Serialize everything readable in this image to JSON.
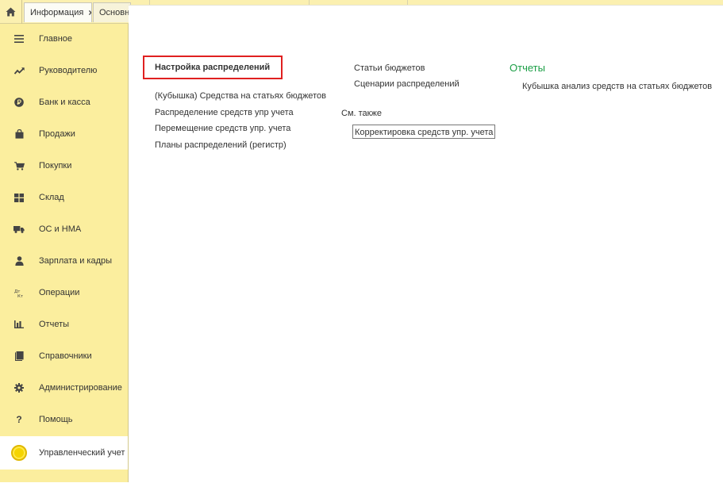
{
  "tabs": {
    "home_label": "Начальная страница",
    "info_label": "Информация",
    "main_label": "Основно"
  },
  "sidebar": {
    "items": [
      {
        "label": "Главное",
        "icon": "menu-lines-icon"
      },
      {
        "label": "Руководителю",
        "icon": "trend-line-icon"
      },
      {
        "label": "Банк и касса",
        "icon": "ruble-coin-icon"
      },
      {
        "label": "Продажи",
        "icon": "shopping-bag-icon"
      },
      {
        "label": "Покупки",
        "icon": "shopping-cart-icon"
      },
      {
        "label": "Склад",
        "icon": "warehouse-grid-icon"
      },
      {
        "label": "ОС и НМА",
        "icon": "truck-icon"
      },
      {
        "label": "Зарплата и кадры",
        "icon": "person-icon"
      },
      {
        "label": "Операции",
        "icon": "debit-credit-icon"
      },
      {
        "label": "Отчеты",
        "icon": "bar-chart-icon"
      },
      {
        "label": "Справочники",
        "icon": "book-icon"
      },
      {
        "label": "Администрирование",
        "icon": "gear-icon"
      },
      {
        "label": "Помощь",
        "icon": "question-icon"
      },
      {
        "label": "Управленческий учет",
        "icon": "yellow-coin-icon",
        "active": true
      }
    ]
  },
  "content": {
    "heading": "Настройка распределений",
    "left_links": [
      "(Кубышка) Средства на статьях бюджетов",
      "Распределение средств упр учета",
      "Перемещение средств упр. учета",
      "Планы распределений (регистр)"
    ],
    "middle_links": [
      "Статьи бюджетов",
      "Сценарии распределений"
    ],
    "see_also_label": "См. также",
    "see_also_link": "Корректировка средств упр. учета",
    "reports_title": "Отчеты",
    "report_links": [
      "Кубышка анализ средств на статьях бюджетов"
    ]
  },
  "colors": {
    "sidebar_bg": "#fbee9e",
    "topbar_bg": "#fbf0b0",
    "reports_green": "#1a9e45",
    "highlight_red": "#e02020"
  }
}
